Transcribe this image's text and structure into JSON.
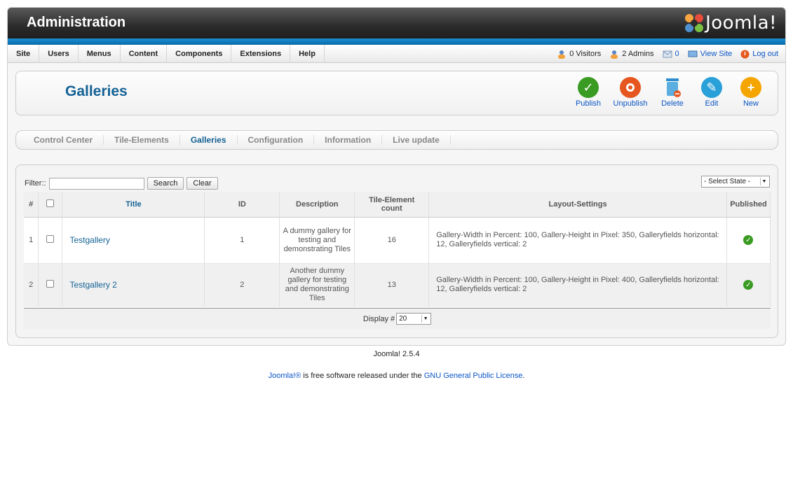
{
  "header": {
    "title": "Administration",
    "logo_text": "Joomla!"
  },
  "menu": [
    "Site",
    "Users",
    "Menus",
    "Content",
    "Components",
    "Extensions",
    "Help"
  ],
  "status": {
    "visitors": "0 Visitors",
    "admins": "2 Admins",
    "messages": "0",
    "view_site": "View Site",
    "logout": "Log out"
  },
  "page_title": "Galleries",
  "toolbar": [
    {
      "label": "Publish",
      "color": "#3a9b22",
      "icon": "check-icon"
    },
    {
      "label": "Unpublish",
      "color": "#e5571f",
      "icon": "unpublish-icon"
    },
    {
      "label": "Delete",
      "color": "#2e8fd0",
      "icon": "trash-icon"
    },
    {
      "label": "Edit",
      "color": "#2aa0d8",
      "icon": "pencil-icon"
    },
    {
      "label": "New",
      "color": "#f5a500",
      "icon": "plus-icon"
    }
  ],
  "subnav": [
    "Control Center",
    "Tile-Elements",
    "Galleries",
    "Configuration",
    "Information",
    "Live update"
  ],
  "subnav_active": "Galleries",
  "filter": {
    "label": "Filter::",
    "value": "",
    "search_label": "Search",
    "clear_label": "Clear"
  },
  "state_select": "- Select State -",
  "table": {
    "headers": [
      "#",
      "",
      "Title",
      "ID",
      "Description",
      "Tile-Element count",
      "Layout-Settings",
      "Published"
    ],
    "rows": [
      {
        "num": "1",
        "title": "Testgallery",
        "id": "1",
        "description": "A dummy gallery for testing and demonstrating Tiles",
        "count": "16",
        "layout": "Gallery-Width in Percent: 100, Gallery-Height in Pixel: 350, Galleryfields horizontal: 12, Galleryfields vertical: 2"
      },
      {
        "num": "2",
        "title": "Testgallery 2",
        "id": "2",
        "description": "Another dummy gallery for testing and demonstrating Tiles",
        "count": "13",
        "layout": "Gallery-Width in Percent: 100, Gallery-Height in Pixel: 400, Galleryfields horizontal: 12, Galleryfields vertical: 2"
      }
    ]
  },
  "display": {
    "label": "Display #",
    "value": "20"
  },
  "footer": {
    "version": "Joomla! 2.5.4",
    "joomla_link": "Joomla!®",
    "text_mid": " is free software released under the ",
    "license_link": "GNU General Public License",
    "text_end": "."
  },
  "colors": {
    "accent": "#146295",
    "header_dark": "#2b2b2b",
    "blue_bar": "#1a8fd2"
  }
}
